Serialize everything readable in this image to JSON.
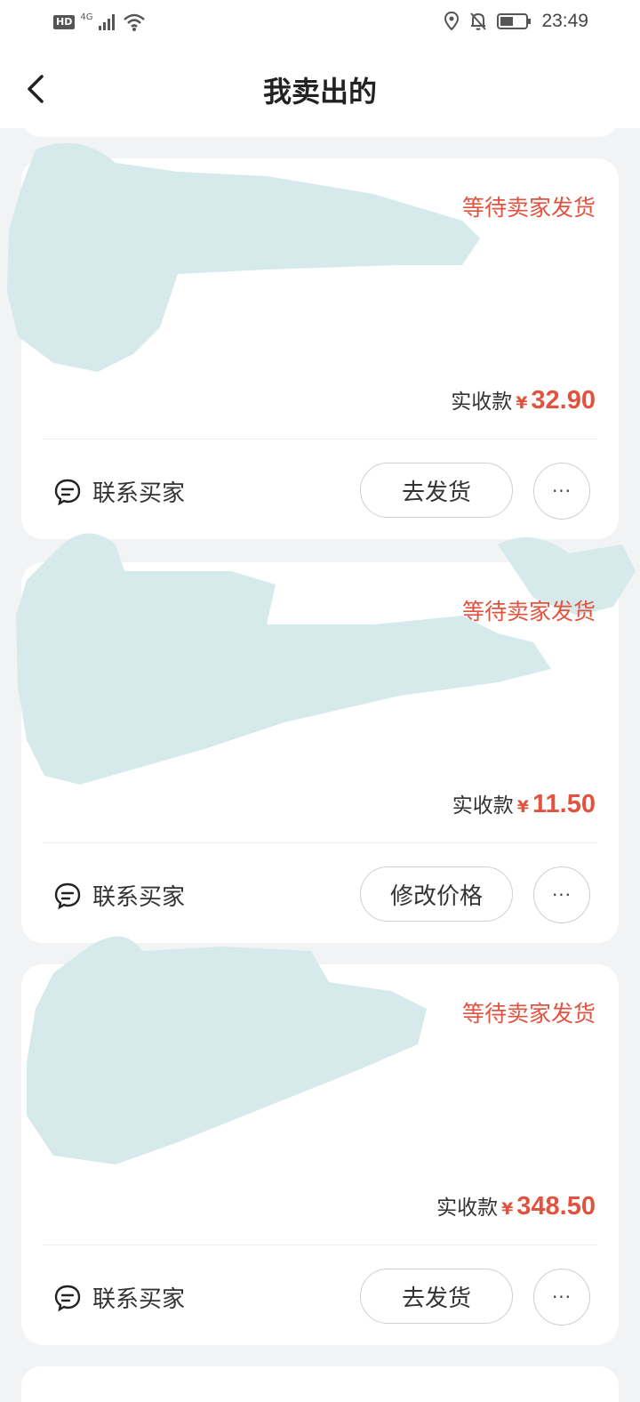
{
  "status_bar": {
    "hd": "HD",
    "network": "4G",
    "time": "23:49"
  },
  "header": {
    "title": "我卖出的"
  },
  "orders": [
    {
      "status": "等待卖家发货",
      "price_label": "实收款",
      "currency": "¥",
      "amount": "32.90",
      "contact_label": "联系买家",
      "action_label": "去发货",
      "more_label": "···"
    },
    {
      "status": "等待卖家发货",
      "price_label": "实收款",
      "currency": "¥",
      "amount": "11.50",
      "contact_label": "联系买家",
      "action_label": "修改价格",
      "more_label": "···"
    },
    {
      "status": "等待卖家发货",
      "price_label": "实收款",
      "currency": "¥",
      "amount": "348.50",
      "contact_label": "联系买家",
      "action_label": "去发货",
      "more_label": "···"
    }
  ],
  "colors": {
    "accent": "#e2533f",
    "background": "#f1f3f5",
    "scribble": "#d6eaec"
  }
}
